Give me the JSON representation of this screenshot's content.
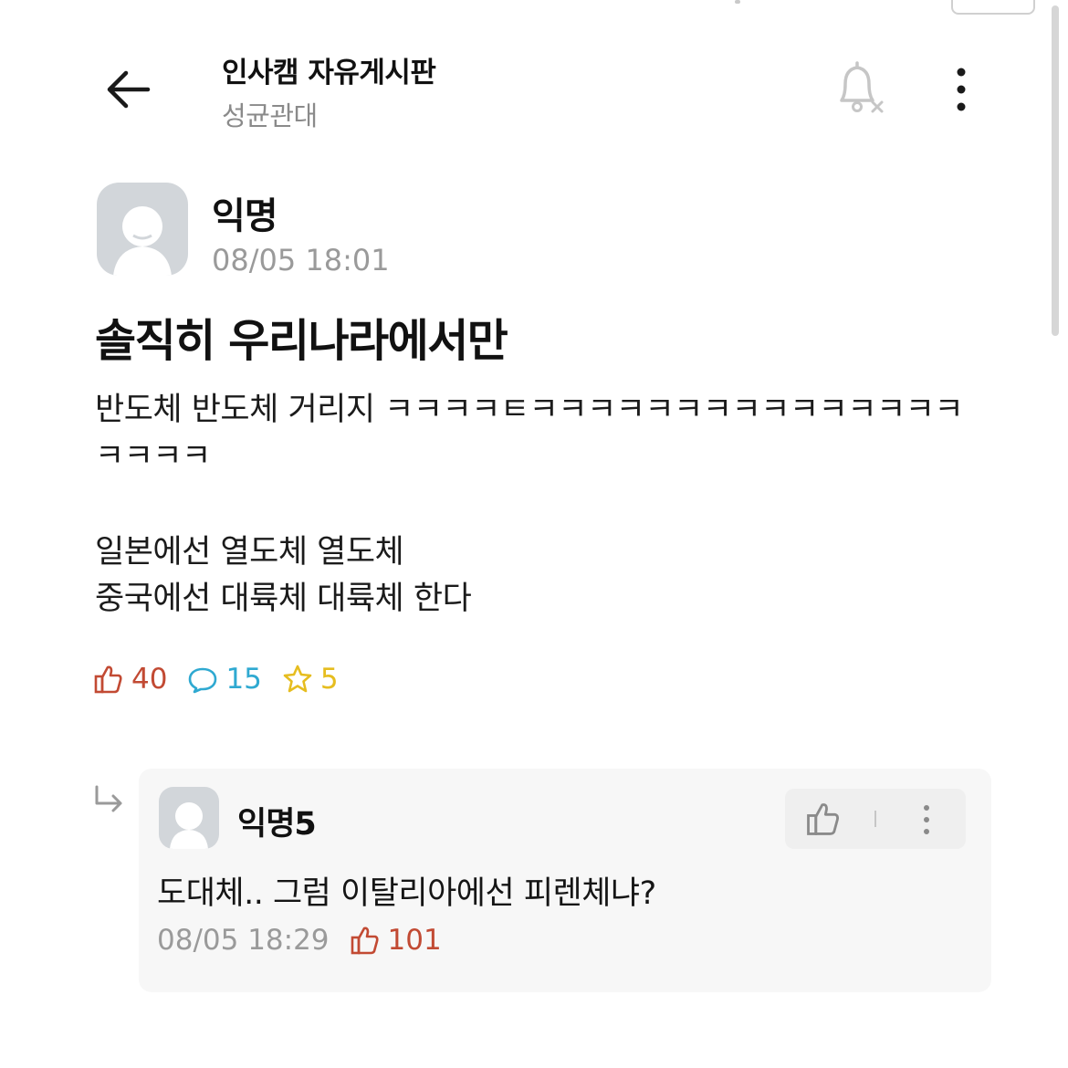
{
  "header": {
    "title": "인사캠 자유게시판",
    "subtitle": "성균관대",
    "back_icon": "arrow-left-icon",
    "bell_icon": "bell-off-icon",
    "more_icon": "more-vertical-icon"
  },
  "post": {
    "author": "익명",
    "time": "08/05 18:01",
    "title": "솔직히 우리나라에서만",
    "body_lines": [
      "반도체 반도체 거리지 ㅋㅋㅋㅋㅌㅋㅋㅋㅋㅋㅋㅋㅋㅋㅋㅋㅋㅋㅋㅋ",
      "ㅋㅋㅋㅋ",
      "일본에선 열도체 열도체",
      "중국에선 대륙체 대륙체 한다"
    ],
    "stats": {
      "likes": "40",
      "comments": "15",
      "scraps": "5"
    }
  },
  "comment": {
    "author": "익명5",
    "text": "도대체.. 그럼 이탈리아에선 피렌체냐?",
    "time": "08/05 18:29",
    "likes": "101"
  },
  "colors": {
    "like": "#c24a33",
    "comment": "#2fa9d1",
    "scrap": "#e6bd1f",
    "muted": "#9a9a9a"
  }
}
